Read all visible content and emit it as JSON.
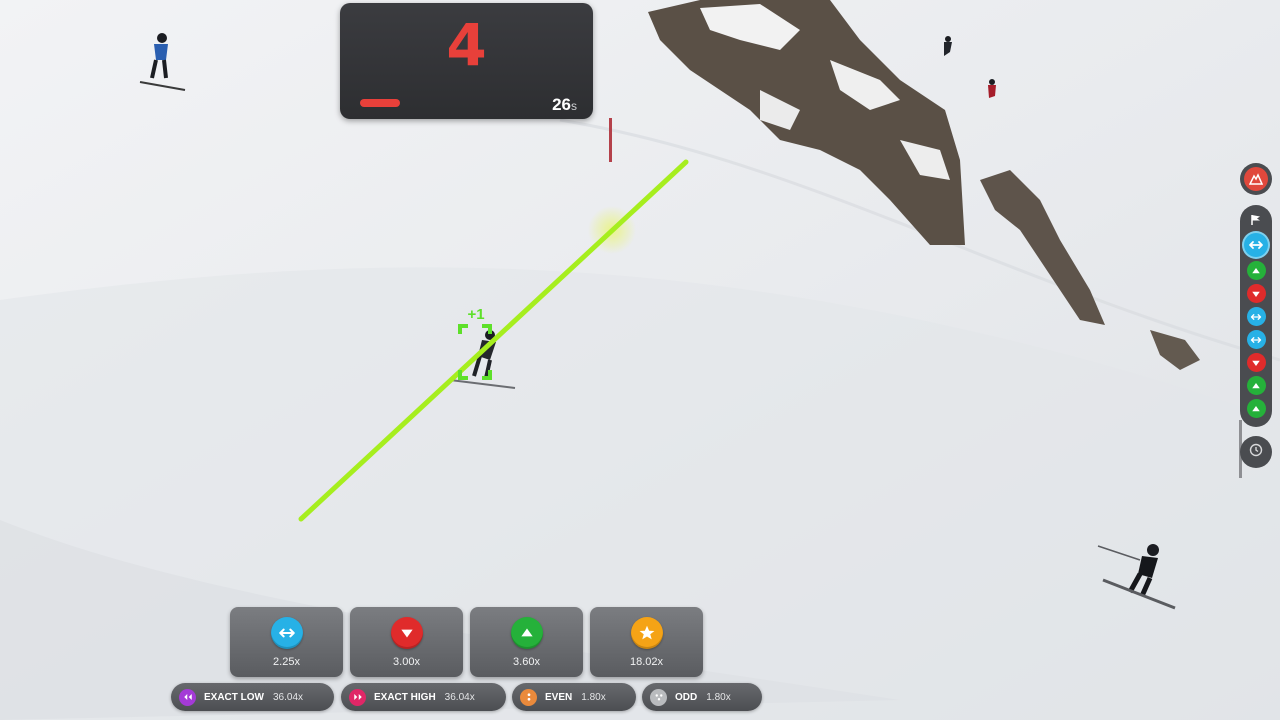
{
  "round": {
    "countdown_value": "4",
    "seconds_left": "26",
    "seconds_unit": "s",
    "plus_marker": "+1"
  },
  "colors": {
    "accent_red": "#e8403a",
    "line_green": "#a6ee1e",
    "side_blue": "#27b1e6",
    "down_red": "#e02b2b",
    "up_green": "#25b13a",
    "star_gold": "#f5a316",
    "exact_low_purple": "#a43ad7",
    "exact_high_pink": "#e02767",
    "even_orange": "#ea8a3c",
    "odd_grey": "#b9bbbe"
  },
  "history_rail": {
    "top_icon": "mountain-icon",
    "header_icon": "flag-icon",
    "items": [
      "side",
      "up",
      "down",
      "side",
      "side",
      "down",
      "up",
      "up"
    ],
    "footer_icon": "clock-icon"
  },
  "bets": [
    {
      "key": "side",
      "icon": "double-arrow-icon",
      "multiplier": "2.25x"
    },
    {
      "key": "down",
      "icon": "triangle-down-icon",
      "multiplier": "3.00x"
    },
    {
      "key": "up",
      "icon": "triangle-up-icon",
      "multiplier": "3.60x"
    },
    {
      "key": "star",
      "icon": "star-icon",
      "multiplier": "18.02x"
    }
  ],
  "side_bets": [
    {
      "label": "EXACT LOW",
      "value": "36.04x",
      "icon": "exact-low-icon"
    },
    {
      "label": "EXACT HIGH",
      "value": "36.04x",
      "icon": "exact-high-icon"
    },
    {
      "label": "EVEN",
      "value": "1.80x",
      "icon": "even-icon"
    },
    {
      "label": "ODD",
      "value": "1.80x",
      "icon": "odd-icon"
    }
  ]
}
